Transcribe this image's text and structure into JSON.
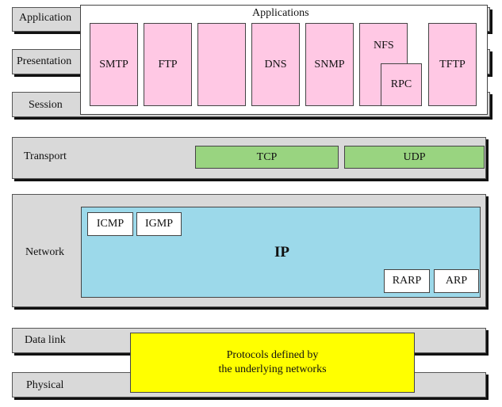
{
  "layers": {
    "application": "Application",
    "presentation": "Presentation",
    "session": "Session",
    "transport": "Transport",
    "network": "Network",
    "data_link": "Data link",
    "physical": "Physical"
  },
  "applications": {
    "title": "Applications",
    "protocols": [
      "SMTP",
      "FTP",
      "",
      "DNS",
      "SNMP",
      "NFS",
      "RPC",
      "TFTP"
    ]
  },
  "transport_protocols": [
    "TCP",
    "UDP"
  ],
  "network": {
    "main": "IP",
    "protocols": [
      "ICMP",
      "IGMP",
      "RARP",
      "ARP"
    ]
  },
  "lower": {
    "line1": "Protocols defined by",
    "line2": "the underlying networks"
  },
  "colors": {
    "layer": "#d9d9d9",
    "application_protocol": "#ffc8e4",
    "transport_protocol": "#99d480",
    "ip": "#9cd9ea",
    "underlying": "#ffff00"
  }
}
